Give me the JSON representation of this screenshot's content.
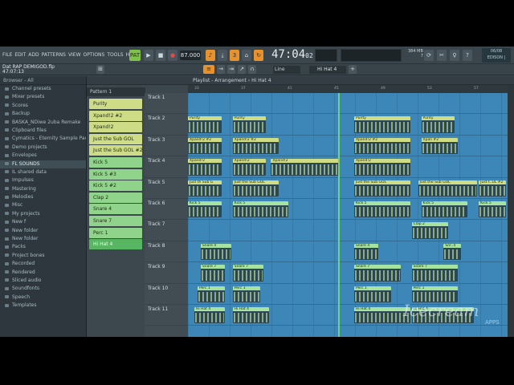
{
  "menu": [
    "FILE",
    "EDIT",
    "ADD",
    "PATTERNS",
    "VIEW",
    "OPTIONS",
    "TOOLS",
    "HELP"
  ],
  "transport": {
    "pat_label": "PAT",
    "song_label": "SONG",
    "bpm": "87.000"
  },
  "time": {
    "main": "47:04",
    "sub": "02"
  },
  "cpu": {
    "line1": "384 MB",
    "line2": "7"
  },
  "edison": {
    "line1": "06/08",
    "line2": "EDISON |"
  },
  "project": {
    "name": "Dat RAP DEMIGOD.flp",
    "time": "47:07:13"
  },
  "snap": "Line",
  "pattern_selector": "Hi Hat 4",
  "browser": {
    "header": "Browser - All",
    "items": [
      "Channel presets",
      "Mixer presets",
      "Scores",
      "Backup",
      "BASKA_NDiwe 2uba Remake",
      "Clipboard files",
      "Cymatics - Eternity Sample Pack",
      "Demo projects",
      "Envelopes",
      "FL SOUNDS",
      "IL shared data",
      "Impulses",
      "Mastering",
      "Melodies",
      "Misc",
      "My projects",
      "New f",
      "New folder",
      "New folder",
      "Packs",
      "Project bones",
      "Recorded",
      "Rendered",
      "Sliced audio",
      "Soundfonts",
      "Speech",
      "Templates"
    ],
    "selected_index": 9
  },
  "rack": {
    "current": "Pattern 1",
    "patterns": [
      {
        "name": "Purity",
        "color": "yellow"
      },
      {
        "name": "Xpand!2 #2",
        "color": "yellow"
      },
      {
        "name": "Xpand!2",
        "color": "yellow"
      },
      {
        "name": "Just the Sub GOL",
        "color": "yellow"
      },
      {
        "name": "Just the Sub GOL #2",
        "color": "yellow"
      },
      {
        "name": "Kick 5",
        "color": "green"
      },
      {
        "name": "Kick 5 #3",
        "color": "green"
      },
      {
        "name": "Kick 5 #2",
        "color": "green"
      },
      {
        "name": "Clap 2",
        "color": "green"
      },
      {
        "name": "Snare 4",
        "color": "green"
      },
      {
        "name": "Snare 7",
        "color": "green"
      },
      {
        "name": "Perc 1",
        "color": "green"
      },
      {
        "name": "Hi Hat 4",
        "color": "sel"
      }
    ]
  },
  "playlist": {
    "title": "Playlist - Arrangement",
    "breadcrumb": "Hi Hat 4",
    "ruler": [
      "33",
      "37",
      "41",
      "45",
      "49",
      "53",
      "57"
    ],
    "tracks": [
      "Track 1",
      "Track 2",
      "Track 3",
      "Track 4",
      "Track 5",
      "Track 6",
      "Track 7",
      "Track 8",
      "Track 9",
      "Track 10",
      "Track 11"
    ],
    "clips": [
      {
        "track": 1,
        "start": 0,
        "len": 0.11,
        "label": "Purity",
        "c": "y"
      },
      {
        "track": 1,
        "start": 0.14,
        "len": 0.11,
        "label": "Purity",
        "c": "y"
      },
      {
        "track": 1,
        "start": 0.52,
        "len": 0.18,
        "label": "Purity",
        "c": "y"
      },
      {
        "track": 1,
        "start": 0.73,
        "len": 0.11,
        "label": "Purity",
        "c": "y"
      },
      {
        "track": 2,
        "start": 0,
        "len": 0.11,
        "label": "Xpand!2 #2",
        "c": "y"
      },
      {
        "track": 2,
        "start": 0.14,
        "len": 0.15,
        "label": "Xpand!2 #2",
        "c": "y"
      },
      {
        "track": 2,
        "start": 0.52,
        "len": 0.18,
        "label": "Xpand!2 #2",
        "c": "y"
      },
      {
        "track": 2,
        "start": 0.73,
        "len": 0.12,
        "label": "Xpan #2",
        "c": "y"
      },
      {
        "track": 3,
        "start": 0,
        "len": 0.11,
        "label": "Xpand!2",
        "c": "y"
      },
      {
        "track": 3,
        "start": 0.14,
        "len": 0.11,
        "label": "Xpand!2",
        "c": "y"
      },
      {
        "track": 3,
        "start": 0.26,
        "len": 0.22,
        "label": "Xpand!2",
        "c": "y"
      },
      {
        "track": 3,
        "start": 0.52,
        "len": 0.18,
        "label": "Xpand!2",
        "c": "y"
      },
      {
        "track": 4,
        "start": 0,
        "len": 0.11,
        "label": "Just th Sub G",
        "c": "y"
      },
      {
        "track": 4,
        "start": 0.14,
        "len": 0.15,
        "label": "Just the Sub GOL",
        "c": "y"
      },
      {
        "track": 4,
        "start": 0.52,
        "len": 0.18,
        "label": "Just the Sub GOL",
        "c": "y"
      },
      {
        "track": 4,
        "start": 0.72,
        "len": 0.19,
        "label": "Just the Sub GOL",
        "c": "y"
      },
      {
        "track": 4,
        "start": 0.91,
        "len": 0.09,
        "label": "Just t..UL #2",
        "c": "y"
      },
      {
        "track": 5,
        "start": 0,
        "len": 0.11,
        "label": "Kick 5",
        "c": "g"
      },
      {
        "track": 5,
        "start": 0.14,
        "len": 0.18,
        "label": "Kick 5",
        "c": "g"
      },
      {
        "track": 5,
        "start": 0.52,
        "len": 0.18,
        "label": "Kick 5",
        "c": "g"
      },
      {
        "track": 5,
        "start": 0.73,
        "len": 0.15,
        "label": "Kick 5",
        "c": "g"
      },
      {
        "track": 5,
        "start": 0.91,
        "len": 0.09,
        "label": "Kick 5",
        "c": "g"
      },
      {
        "track": 6,
        "start": 0.7,
        "len": 0.12,
        "label": "Clap 2",
        "c": "g"
      },
      {
        "track": 7,
        "start": 0.04,
        "len": 0.1,
        "label": "Snare 4",
        "c": "g"
      },
      {
        "track": 7,
        "start": 0.52,
        "len": 0.08,
        "label": "Snare 4",
        "c": "g"
      },
      {
        "track": 7,
        "start": 0.8,
        "len": 0.06,
        "label": "Snr..4",
        "c": "g"
      },
      {
        "track": 8,
        "start": 0.04,
        "len": 0.08,
        "label": "Snare 7",
        "c": "g"
      },
      {
        "track": 8,
        "start": 0.14,
        "len": 0.1,
        "label": "Snare 7",
        "c": "g"
      },
      {
        "track": 8,
        "start": 0.52,
        "len": 0.15,
        "label": "Snare 7",
        "c": "g"
      },
      {
        "track": 8,
        "start": 0.7,
        "len": 0.15,
        "label": "Snare 7",
        "c": "g"
      },
      {
        "track": 9,
        "start": 0.03,
        "len": 0.09,
        "label": "Perc 1",
        "c": "g"
      },
      {
        "track": 9,
        "start": 0.14,
        "len": 0.09,
        "label": "Perc 1",
        "c": "g"
      },
      {
        "track": 9,
        "start": 0.52,
        "len": 0.12,
        "label": "Perc 1",
        "c": "g"
      },
      {
        "track": 9,
        "start": 0.7,
        "len": 0.15,
        "label": "Perc 1",
        "c": "g"
      },
      {
        "track": 10,
        "start": 0.02,
        "len": 0.1,
        "label": "Hi Hat 4",
        "c": "g"
      },
      {
        "track": 10,
        "start": 0.14,
        "len": 0.12,
        "label": "Hi Hat 4",
        "c": "g"
      },
      {
        "track": 10,
        "start": 0.52,
        "len": 0.18,
        "label": "Hi Hat 4",
        "c": "g"
      },
      {
        "track": 10,
        "start": 0.7,
        "len": 0.2,
        "label": "Hi Hat 4",
        "c": "g"
      }
    ]
  },
  "watermark": {
    "main": "Icecream",
    "sub": "APPS"
  }
}
